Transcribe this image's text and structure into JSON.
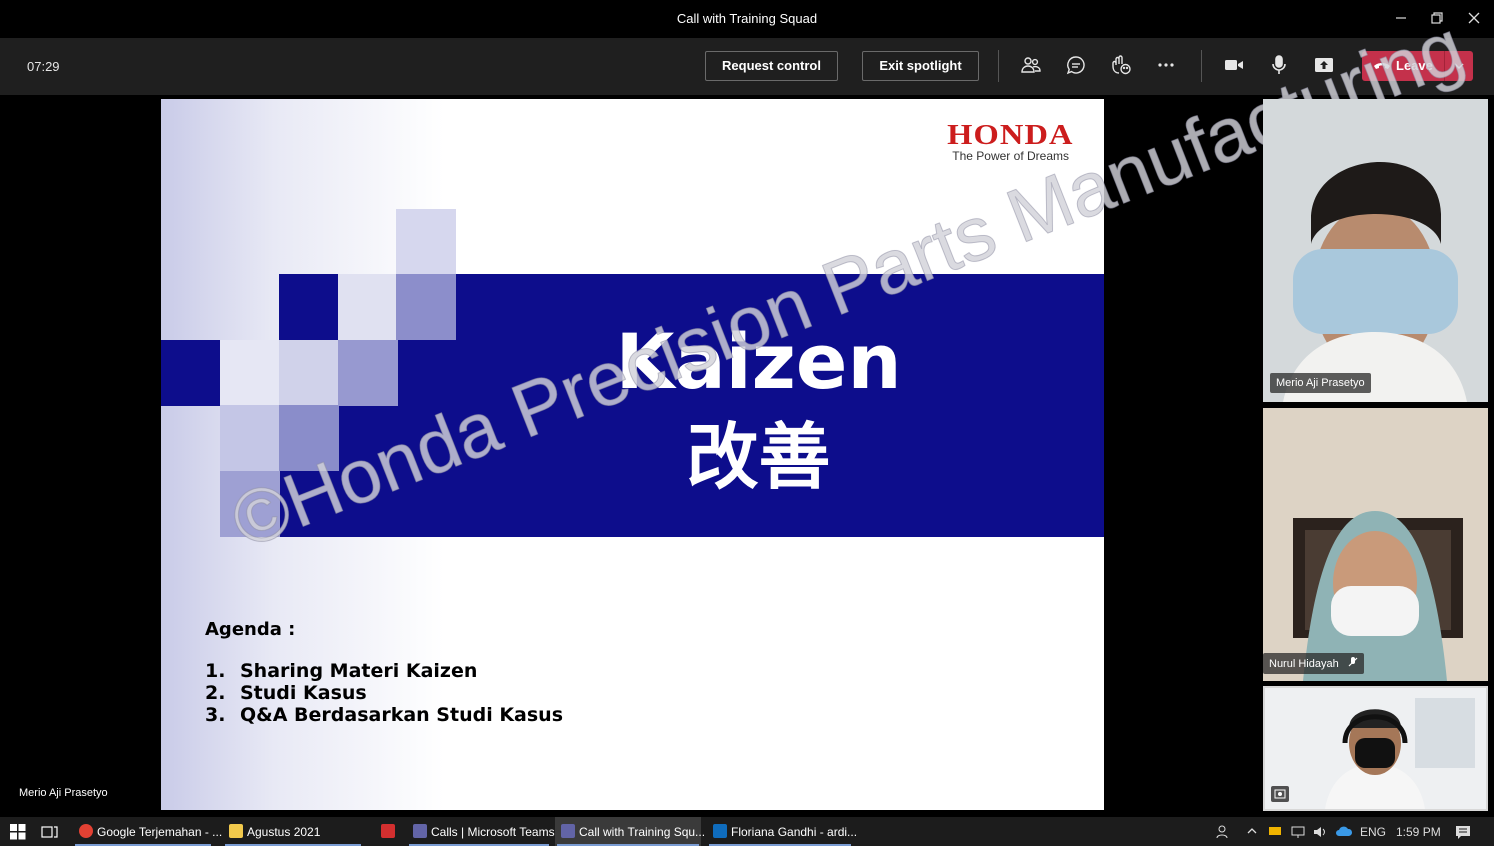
{
  "window": {
    "title": "Call with Training Squad"
  },
  "toolbar": {
    "timer": "07:29",
    "request_control": "Request control",
    "exit_spotlight": "Exit spotlight",
    "leave": "Leave"
  },
  "slide": {
    "brand": "HONDA",
    "tagline": "The Power of Dreams",
    "title": "Kaizen",
    "subtitle": "改善",
    "agenda_heading": "Agenda :",
    "agenda": [
      {
        "num": "1.",
        "text": "Sharing Materi Kaizen"
      },
      {
        "num": "2.",
        "text": "Studi Kasus"
      },
      {
        "num": "3.",
        "text": "Q&A Berdasarkan Studi Kasus"
      }
    ],
    "watermark": "©Honda Precision Parts Manufacturing"
  },
  "spotlight_name": "Merio Aji Prasetyo",
  "participants": [
    {
      "name": "Merio Aji Prasetyo"
    },
    {
      "name": "Nurul Hidayah"
    }
  ],
  "taskbar": {
    "apps": [
      {
        "label": "Google Terjemahan - ...",
        "color": "#e34133"
      },
      {
        "label": "Agustus 2021",
        "color": "#f2c94c"
      },
      {
        "label": "",
        "color": "#d32f2f"
      },
      {
        "label": "Calls | Microsoft Teams",
        "color": "#6264a7"
      },
      {
        "label": "Call with Training Squ...",
        "color": "#6264a7"
      },
      {
        "label": "Floriana Gandhi - ardi...",
        "color": "#0f6cbd"
      }
    ],
    "lang": "ENG",
    "time": "1:59 PM"
  }
}
